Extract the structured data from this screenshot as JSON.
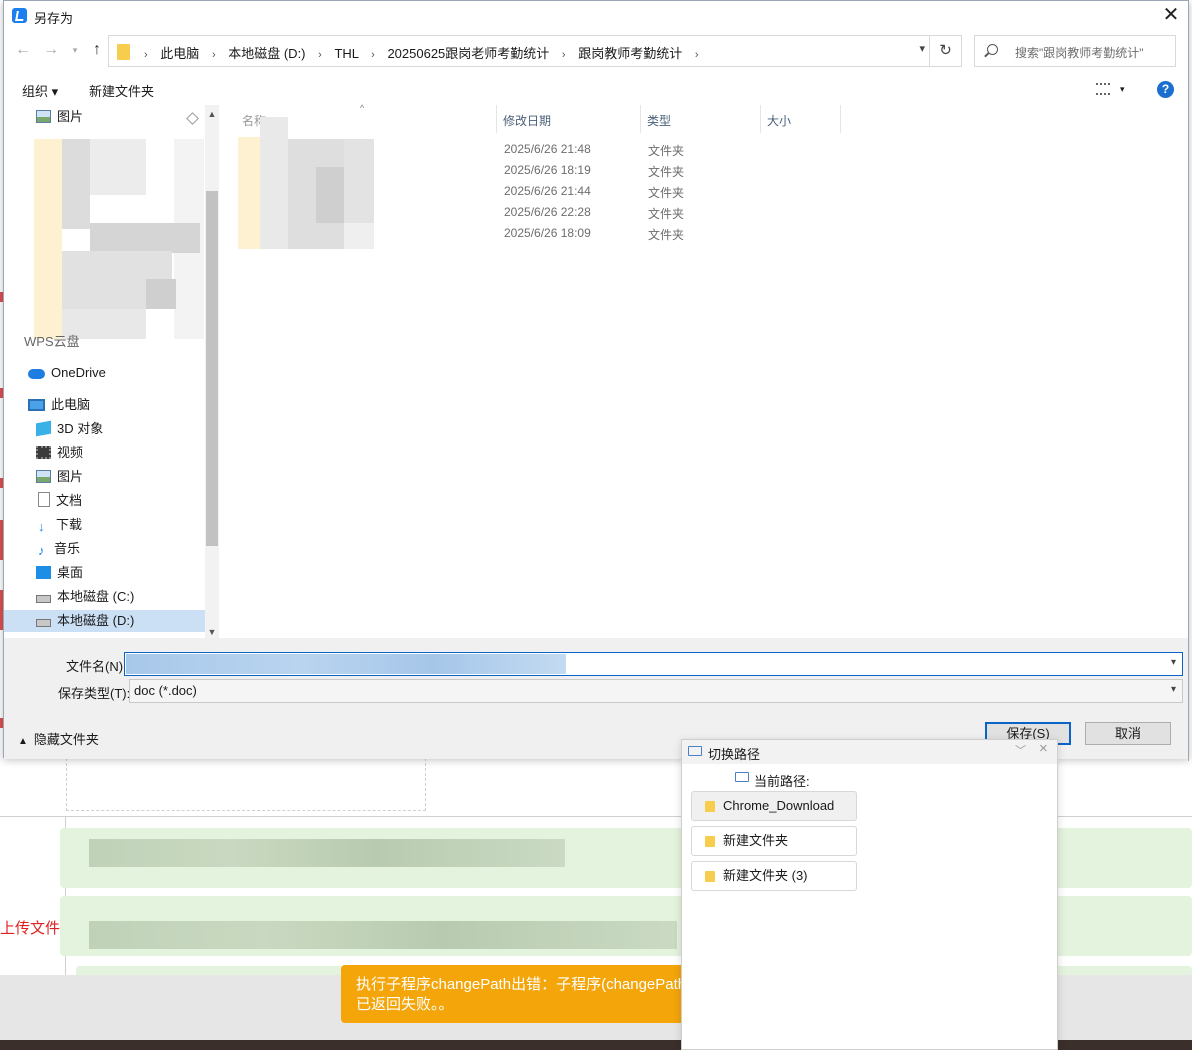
{
  "dialog": {
    "title": "另存为",
    "close_glyph": "✕",
    "breadcrumbs": [
      "此电脑",
      "本地磁盘 (D:)",
      "THL",
      "20250625跟岗老师考勤统计",
      "跟岗教师考勤统计"
    ],
    "search_placeholder": "搜索\"跟岗教师考勤统计\"",
    "toolbar": {
      "organize": "组织 ▾",
      "new_folder": "新建文件夹"
    },
    "nav": {
      "quick_pictures": "图片",
      "onedrive": "OneDrive",
      "this_pc": "此电脑",
      "items": [
        "3D 对象",
        "视频",
        "图片",
        "文档",
        "下载",
        "音乐",
        "桌面",
        "本地磁盘 (C:)",
        "本地磁盘 (D:)"
      ],
      "partial_top": "WPS云盘"
    },
    "columns": {
      "name": "名称",
      "date": "修改日期",
      "type": "类型",
      "size": "大小"
    },
    "rows": [
      {
        "date": "2025/6/26 21:48",
        "type": "文件夹"
      },
      {
        "date": "2025/6/26 18:19",
        "type": "文件夹"
      },
      {
        "date": "2025/6/26 21:44",
        "type": "文件夹"
      },
      {
        "date": "2025/6/26 22:28",
        "type": "文件夹"
      },
      {
        "date": "2025/6/26 18:09",
        "type": "文件夹"
      }
    ],
    "filename_label": "文件名(N):",
    "filetype_label": "保存类型(T):",
    "filetype_value": "doc (*.doc)",
    "hide_folders": "隐藏文件夹",
    "save_button": "保存(S)",
    "cancel_button": "取消"
  },
  "path_panel": {
    "title": "切换路径",
    "current_path_label": "当前路径:",
    "items": [
      "Chrome_Download",
      "新建文件夹",
      "新建文件夹 (3)"
    ]
  },
  "background": {
    "upload_label": "上传文件",
    "toast": "执行子程序changePath出错：子程序(changePath)\n已返回失败。。"
  },
  "colors": {
    "accent": "#0a64c8",
    "toast": "#f3a50a",
    "error": "#e02020"
  }
}
